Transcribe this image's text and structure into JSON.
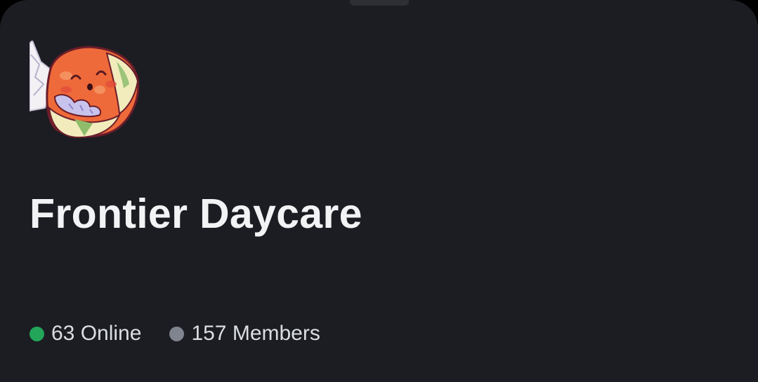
{
  "server": {
    "name": "Frontier Daycare",
    "icon": "pokemon-egg-mascot-icon"
  },
  "stats": {
    "online_label": "63 Online",
    "members_label": "157 Members"
  },
  "colors": {
    "background": "#1c1d22",
    "online_dot": "#23a55a",
    "members_dot": "#80848e",
    "title_text": "#f2f3f5",
    "stat_text": "#dbdee1"
  }
}
